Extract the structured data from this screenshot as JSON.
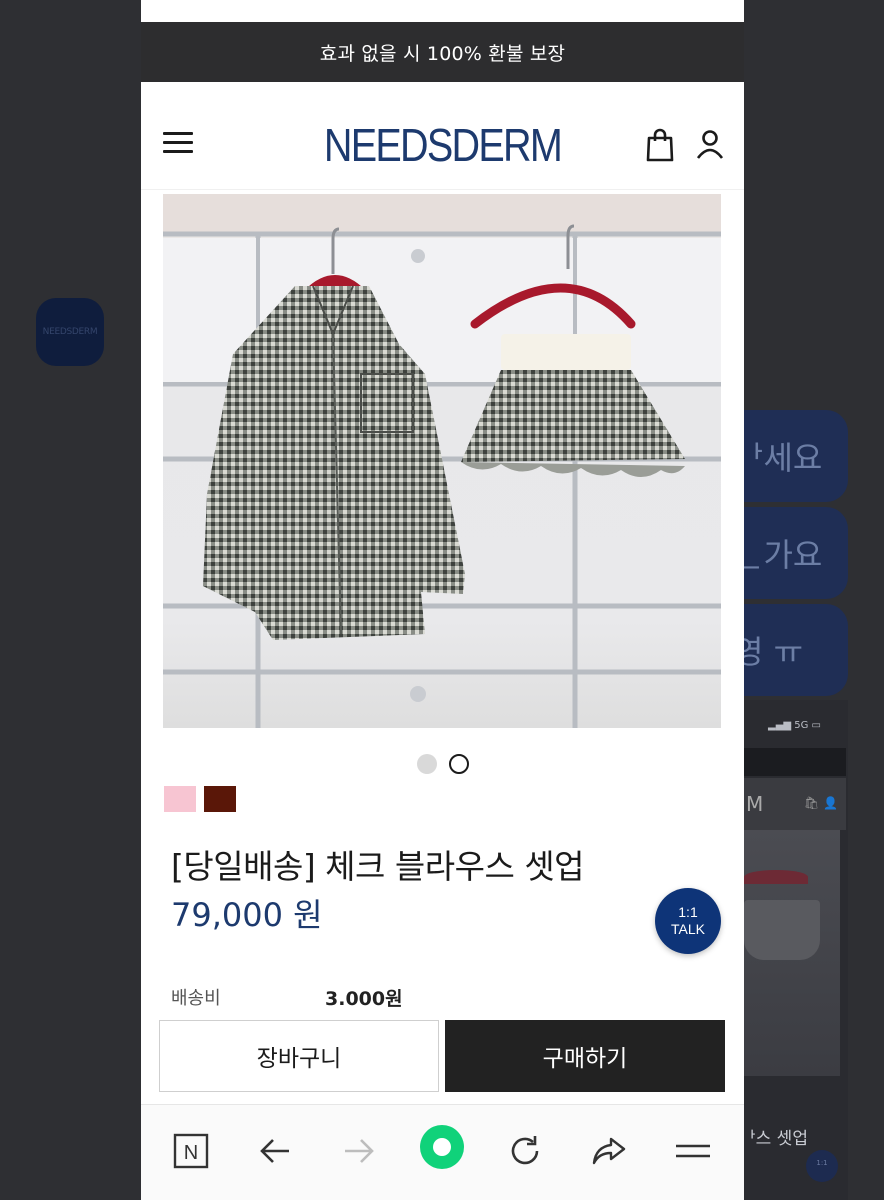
{
  "notice_bar": {
    "text": "효과 없을 시 100% 환불 보장"
  },
  "header": {
    "logo": "NEEDSDERM"
  },
  "product": {
    "image_alt": "체크 셔츠와 체크 플리츠 스커트가 옷걸이에 걸린 사진",
    "gallery": {
      "total": 2,
      "current": 1
    },
    "colors": [
      "#f7c5d2",
      "#5a1708"
    ],
    "title": "[당일배송] 체크 블라우스 셋업",
    "price": "79,000 원"
  },
  "shipping": {
    "label": "배송비",
    "value": "3.000원"
  },
  "actions": {
    "cart_label": "장바구니",
    "buy_label": "구매하기"
  },
  "talk_button": {
    "line1": "1:1",
    "line2": "TALK"
  },
  "browser_toolbar": {
    "items": [
      "n-home-icon",
      "back-arrow-icon",
      "forward-arrow-icon",
      "green-dot-icon",
      "reload-icon",
      "share-icon",
      "menu-icon"
    ]
  },
  "background": {
    "avatar_text": "NEEDSDERM",
    "bubbles": [
      "ᅡ세요",
      "ᆫ가요",
      "영 ㅠ"
    ],
    "status_text": "5G",
    "header_text": "M",
    "product_text": "ᅡ스 셋업"
  },
  "colors": {
    "brand": "#1d3a6e",
    "talk": "#0e3478",
    "dark": "#222222",
    "notice_bg": "#2d2d2f"
  }
}
